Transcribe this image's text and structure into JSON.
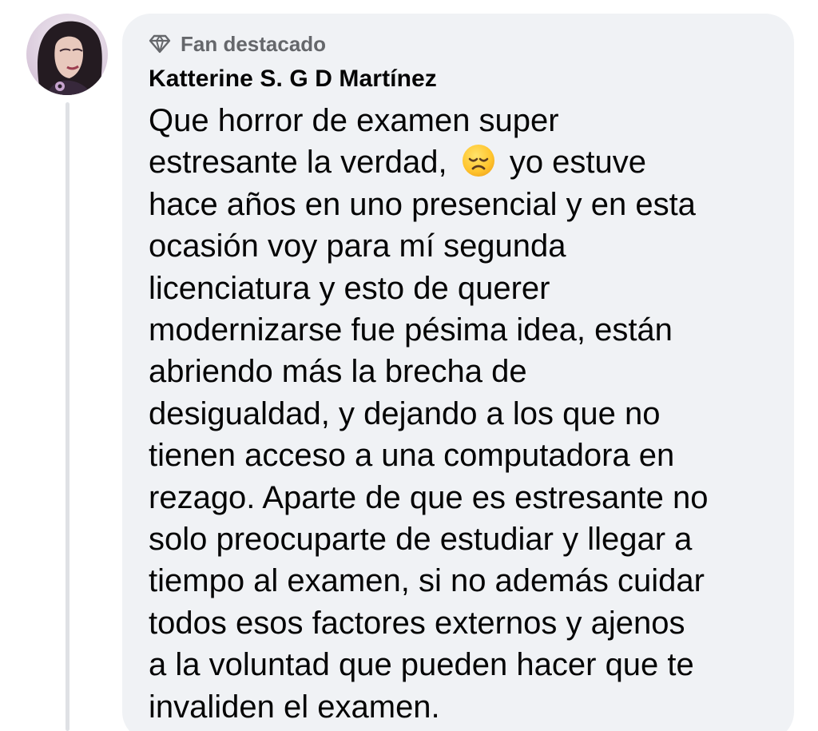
{
  "comment": {
    "badge": {
      "icon": "diamond-icon",
      "label": "Fan destacado"
    },
    "author": "Katterine S. G D Martínez",
    "avatar": {
      "icon": "profile-photo"
    },
    "emoji": {
      "icon": "disappointed-face-emoji",
      "char": "😞"
    },
    "lines": [
      "Que horror de examen super",
      "estresante la verdad,",
      "yo estuve",
      "hace años en uno presencial y en esta",
      "ocasión voy para mí segunda",
      "licenciatura y esto de querer",
      "modernizarse fue pésima idea, están",
      "abriendo más la brecha de",
      "desigualdad, y dejando a los que no",
      "tienen acceso a una computadora en",
      "rezago. Aparte de que es estresante no",
      "solo preocuparte de estudiar y llegar a",
      "tiempo al examen, si no además cuidar",
      "todos esos factores externos y ajenos",
      "a la voluntad que pueden hacer que te",
      "invaliden el examen."
    ]
  },
  "colors": {
    "bubble_background": "#f0f2f5",
    "secondary_text": "#65676b",
    "primary_text": "#050505",
    "thread_line": "#dfe1e5"
  }
}
